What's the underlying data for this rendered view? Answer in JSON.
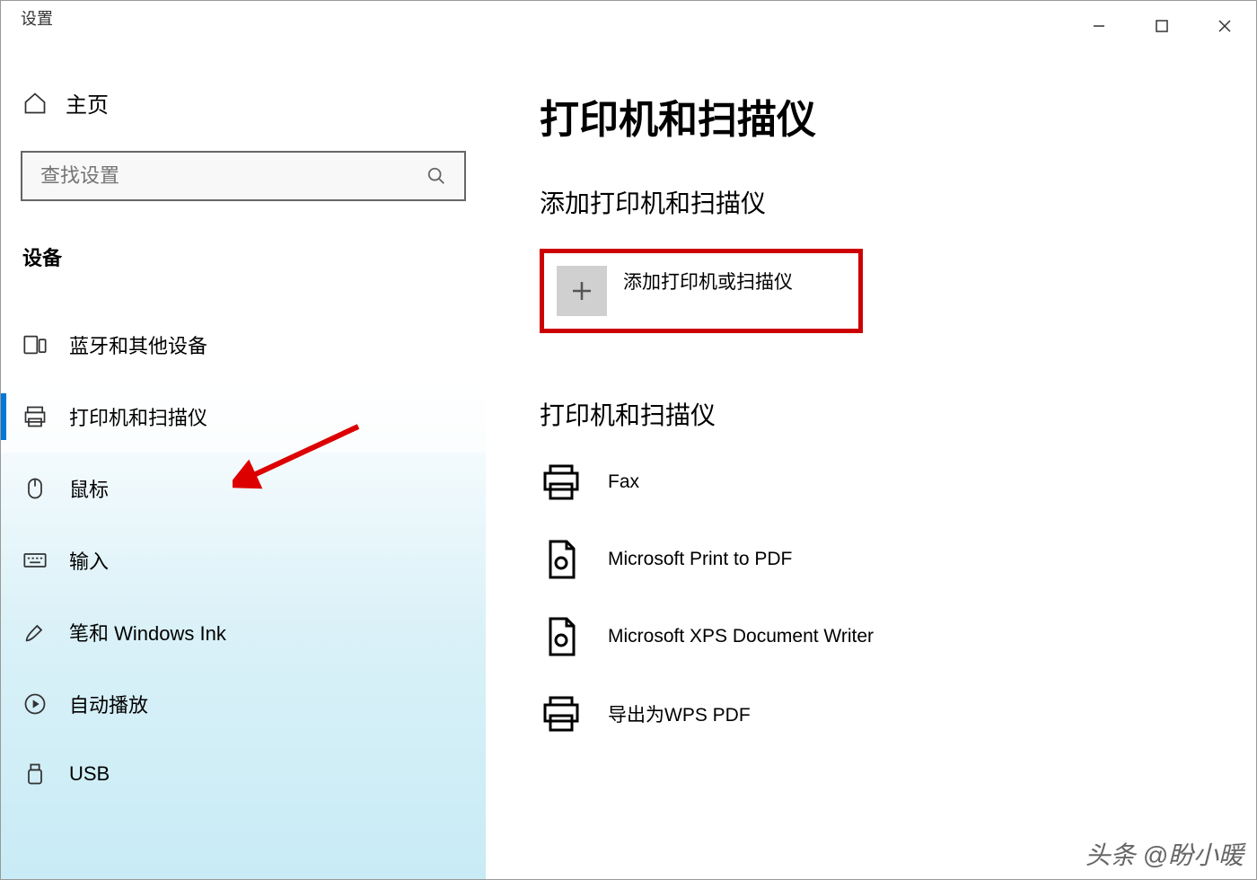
{
  "window": {
    "title": "设置"
  },
  "sidebar": {
    "home_label": "主页",
    "search_placeholder": "查找设置",
    "category_label": "设备",
    "items": [
      {
        "label": "蓝牙和其他设备",
        "icon": "bluetooth-devices-icon"
      },
      {
        "label": "打印机和扫描仪",
        "icon": "printer-icon",
        "selected": true
      },
      {
        "label": "鼠标",
        "icon": "mouse-icon"
      },
      {
        "label": "输入",
        "icon": "keyboard-icon"
      },
      {
        "label": "笔和 Windows Ink",
        "icon": "pen-icon"
      },
      {
        "label": "自动播放",
        "icon": "autoplay-icon"
      },
      {
        "label": "USB",
        "icon": "usb-icon"
      }
    ]
  },
  "main": {
    "page_title": "打印机和扫描仪",
    "add_section_title": "添加打印机和扫描仪",
    "add_button_label": "添加打印机或扫描仪",
    "list_section_title": "打印机和扫描仪",
    "printers": [
      {
        "label": "Fax"
      },
      {
        "label": "Microsoft Print to PDF"
      },
      {
        "label": "Microsoft XPS Document Writer"
      },
      {
        "label": "导出为WPS PDF"
      }
    ]
  },
  "watermark": "头条 @盼小暖"
}
